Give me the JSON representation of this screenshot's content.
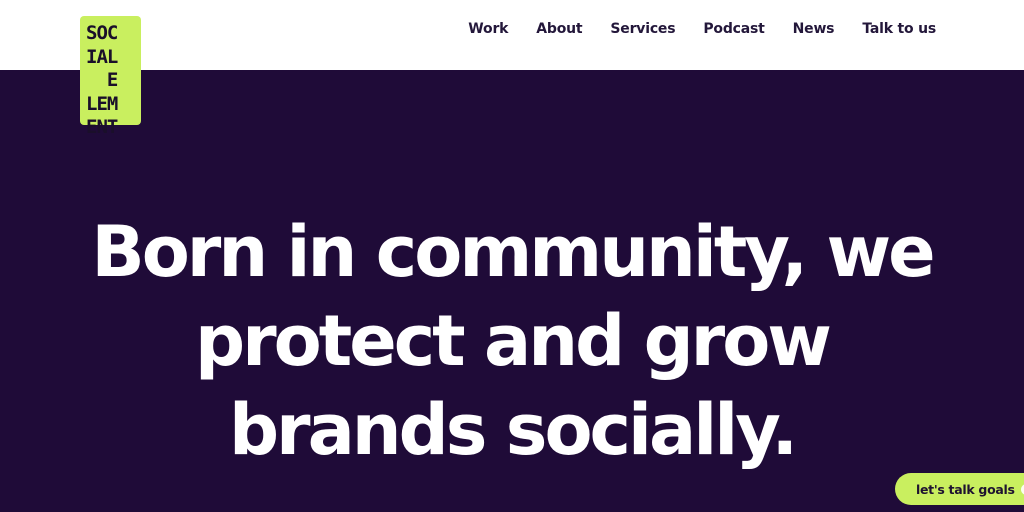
{
  "header": {
    "logo_lines": [
      "SOC",
      "IAL",
      "  E",
      "LEM",
      "ENT"
    ],
    "nav": [
      {
        "label": "Work"
      },
      {
        "label": "About"
      },
      {
        "label": "Services"
      },
      {
        "label": "Podcast"
      },
      {
        "label": "News"
      },
      {
        "label": "Talk to us"
      }
    ]
  },
  "hero": {
    "lines": [
      "Born in community, we",
      "protect and grow",
      "brands socially."
    ]
  },
  "cta": {
    "label": "let's talk goals",
    "icon": "chat-bubble-icon"
  },
  "colors": {
    "background": "#1f0b38",
    "accent": "#c9ef5f",
    "header": "#ffffff",
    "text_on_dark": "#ffffff"
  }
}
